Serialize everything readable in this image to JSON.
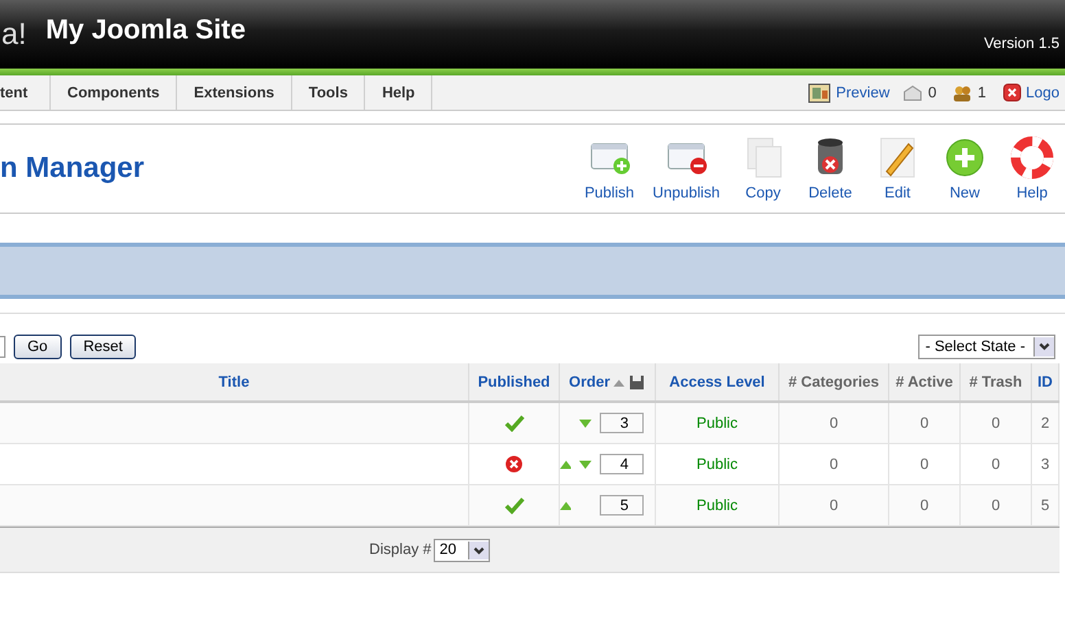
{
  "header": {
    "logo_fragment": "a!",
    "site_title": "My Joomla Site",
    "version": "Version 1.5"
  },
  "menu": {
    "items": [
      "tent",
      "Components",
      "Extensions",
      "Tools",
      "Help"
    ],
    "preview": "Preview",
    "messages": "0",
    "users": "1",
    "logout": "Logo"
  },
  "toolbar": {
    "title": "n Manager",
    "buttons": [
      {
        "kind": "publish",
        "label": "Publish"
      },
      {
        "kind": "unpublish",
        "label": "Unpublish"
      },
      {
        "kind": "copy",
        "label": "Copy"
      },
      {
        "kind": "delete",
        "label": "Delete"
      },
      {
        "kind": "edit",
        "label": "Edit"
      },
      {
        "kind": "new",
        "label": "New"
      },
      {
        "kind": "help",
        "label": "Help"
      }
    ]
  },
  "filter": {
    "go": "Go",
    "reset": "Reset",
    "state_select": "- Select State -"
  },
  "table": {
    "columns": [
      "Title",
      "Published",
      "Order",
      "Access Level",
      "# Categories",
      "# Active",
      "# Trash",
      "ID"
    ],
    "rows": [
      {
        "published": true,
        "order_up": false,
        "order_down": true,
        "order": "3",
        "access": "Public",
        "categories": "0",
        "active": "0",
        "trash": "0",
        "id": "2"
      },
      {
        "published": false,
        "order_up": true,
        "order_down": true,
        "order": "4",
        "access": "Public",
        "categories": "0",
        "active": "0",
        "trash": "0",
        "id": "3"
      },
      {
        "published": true,
        "order_up": true,
        "order_down": false,
        "order": "5",
        "access": "Public",
        "categories": "0",
        "active": "0",
        "trash": "0",
        "id": "5"
      }
    ],
    "display_label": "Display #",
    "display_value": "20"
  }
}
